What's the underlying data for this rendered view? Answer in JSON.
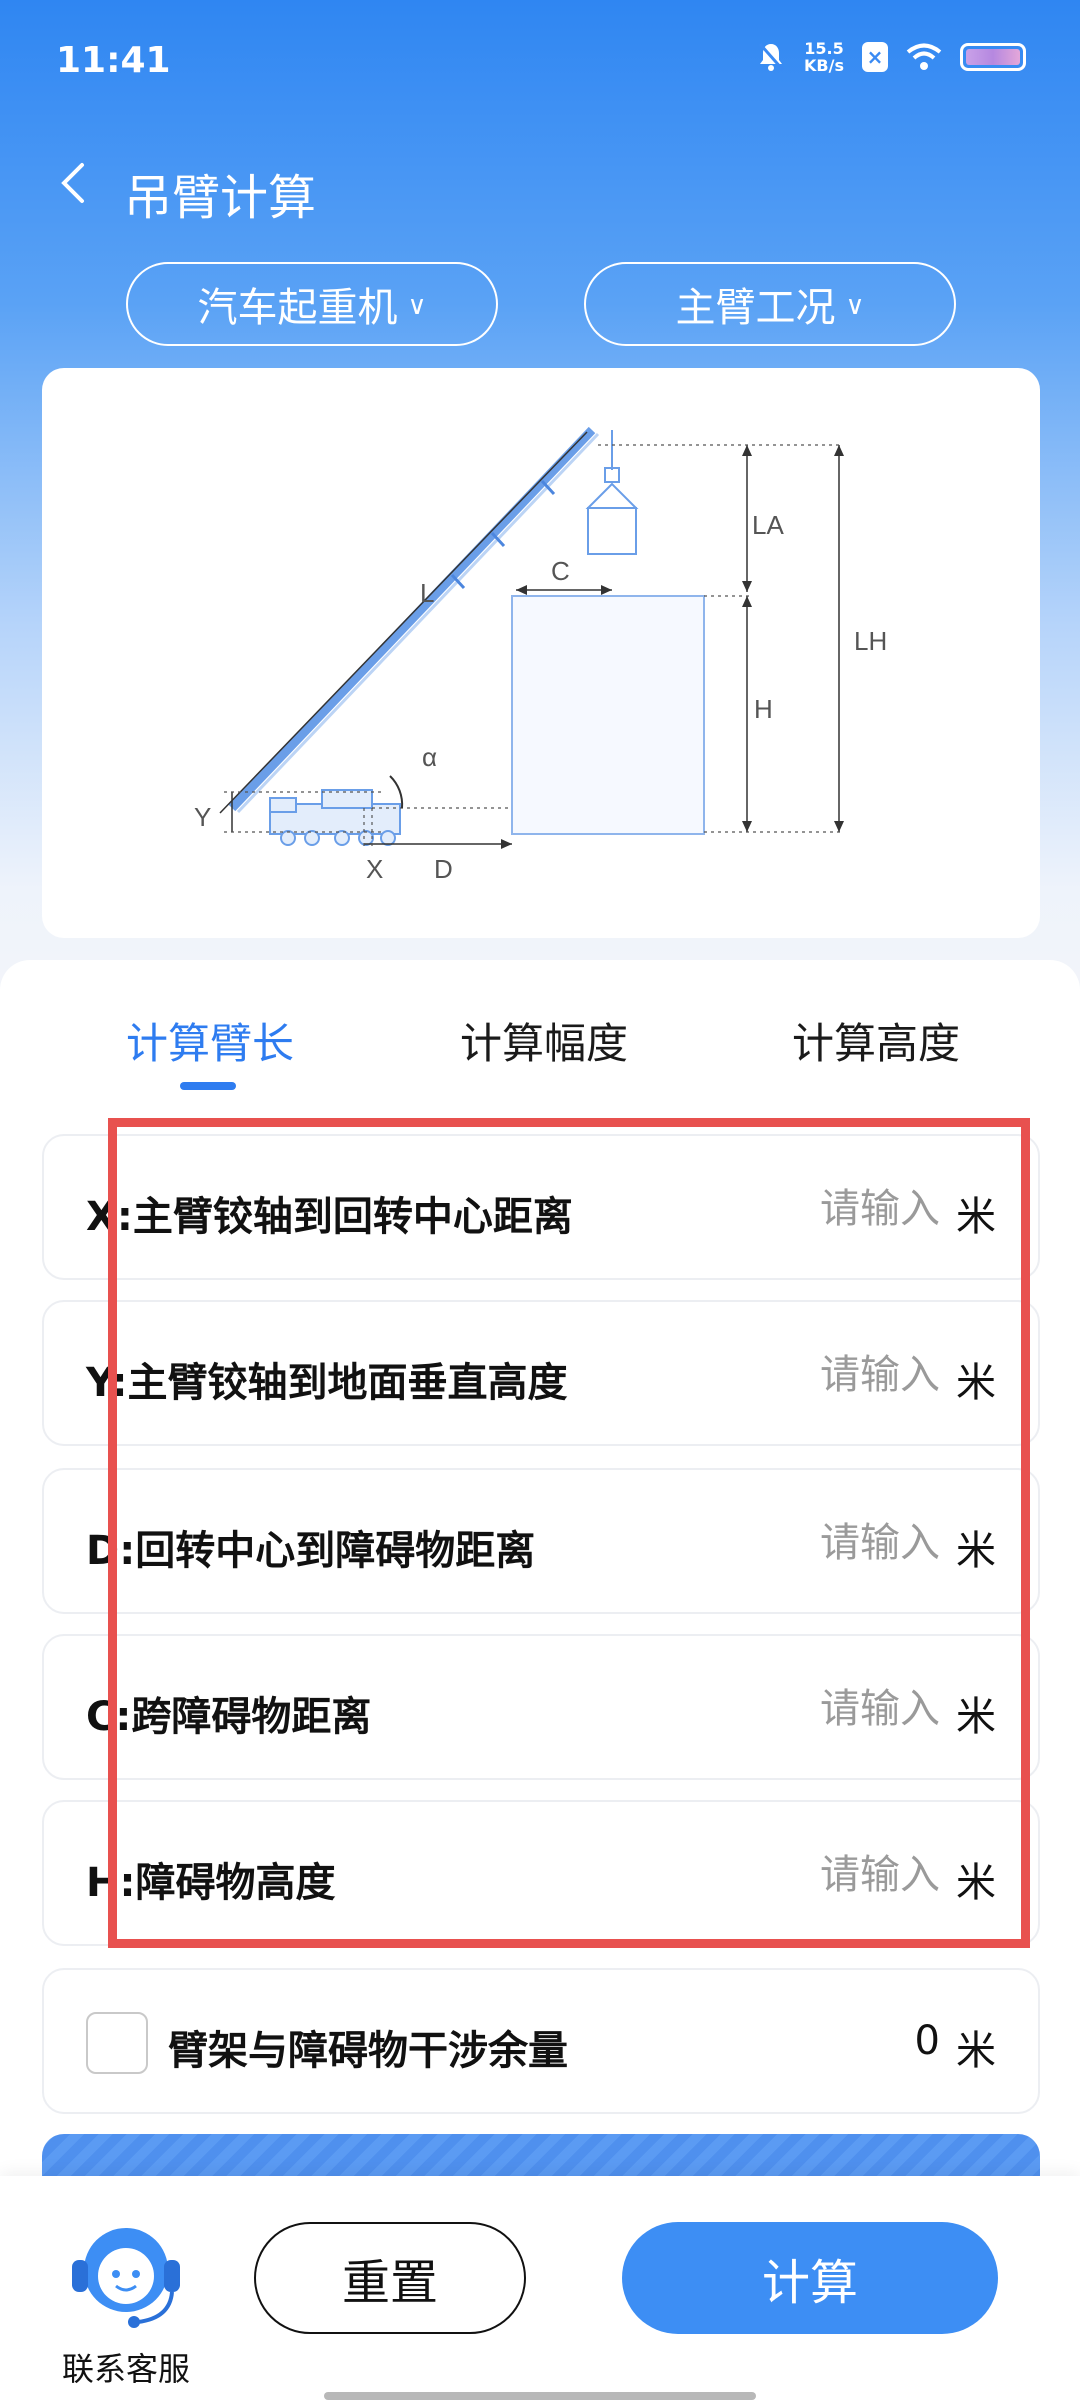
{
  "status": {
    "time": "11:41",
    "speed_value": "15.5",
    "speed_unit": "KB/s"
  },
  "nav": {
    "title": "吊臂计算"
  },
  "selectors": {
    "type": "汽车起重机",
    "mode": "主臂工况"
  },
  "diagram": {
    "labels": {
      "L": "L",
      "C": "C",
      "LA": "LA",
      "LH": "LH",
      "H": "H",
      "alpha": "α",
      "Y": "Y",
      "X": "X",
      "D": "D"
    },
    "colors": {
      "boom": "#6a9ee8",
      "dimension": "#333333"
    }
  },
  "tabs": [
    {
      "label": "计算臂长",
      "active": true
    },
    {
      "label": "计算幅度",
      "active": false
    },
    {
      "label": "计算高度",
      "active": false
    }
  ],
  "inputs": [
    {
      "label": "X:主臂铰轴到回转中心距离",
      "placeholder": "请输入",
      "unit": "米"
    },
    {
      "label": "Y:主臂铰轴到地面垂直高度",
      "placeholder": "请输入",
      "unit": "米"
    },
    {
      "label": "D:回转中心到障碍物距离",
      "placeholder": "请输入",
      "unit": "米"
    },
    {
      "label": "C:跨障碍物距离",
      "placeholder": "请输入",
      "unit": "米"
    },
    {
      "label": "H:障碍物高度",
      "placeholder": "请输入",
      "unit": "米"
    }
  ],
  "clearance": {
    "label": "臂架与障碍物干涉余量",
    "value": "0",
    "unit": "米",
    "checked": false
  },
  "bottom": {
    "support_label": "联系客服",
    "reset_label": "重置",
    "calc_label": "计算"
  },
  "colors": {
    "accent": "#2e7cf0",
    "highlight": "#e8514f"
  }
}
